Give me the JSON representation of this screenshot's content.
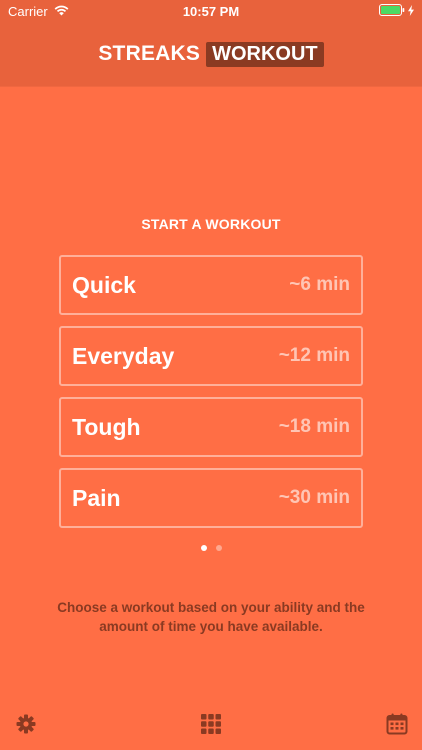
{
  "status_bar": {
    "carrier": "Carrier",
    "time": "10:57 PM"
  },
  "header": {
    "brand": "STREAKS",
    "brand_tag": "WORKOUT"
  },
  "main": {
    "section_title": "START A WORKOUT",
    "workouts": [
      {
        "name": "Quick",
        "duration": "~6 min"
      },
      {
        "name": "Everyday",
        "duration": "~12 min"
      },
      {
        "name": "Tough",
        "duration": "~18 min"
      },
      {
        "name": "Pain",
        "duration": "~30 min"
      }
    ],
    "pager": {
      "pages": 2,
      "current": 1
    },
    "helper_text": "Choose a workout based on your ability and the amount of time you have available."
  },
  "tab_bar": {
    "icons": [
      "gear-icon",
      "grid-icon",
      "calendar-icon"
    ]
  },
  "colors": {
    "background": "#FF6E45",
    "header": "#E8623C",
    "accent_dark": "#8A3A22",
    "battery": "#4CD964"
  }
}
